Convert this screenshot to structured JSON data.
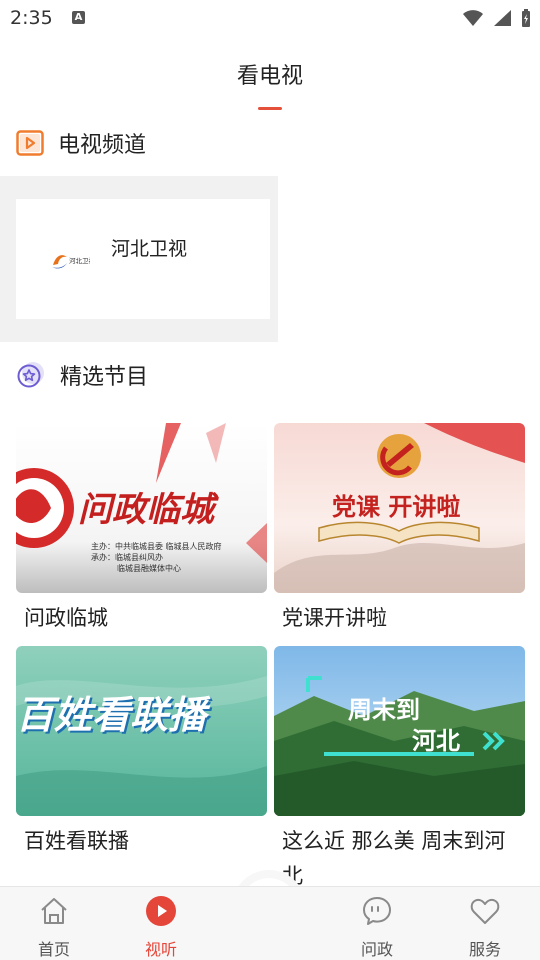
{
  "status_bar": {
    "time": "2:35",
    "notification_icon": "A"
  },
  "header": {
    "title": "看电视"
  },
  "tv_channels": {
    "section_title": "电视频道",
    "section_icon": "play-square-icon",
    "channels": [
      {
        "name": "河北卫视",
        "logo_text": "河北卫视"
      }
    ]
  },
  "featured": {
    "section_title": "精选节目",
    "section_icon": "star-badge-icon",
    "programs": [
      {
        "title": "问政临城",
        "thumb_title": "问政临城",
        "thumb_credits": [
          "主办：中共临城县委 临城县人民政府",
          "承办：临城县纠风办",
          "临城县融媒体中心"
        ]
      },
      {
        "title": "党课开讲啦",
        "thumb_title": "党课  开讲啦"
      },
      {
        "title": "百姓看联播",
        "thumb_title": "百姓看联播"
      },
      {
        "title": "这么近 那么美 周末到河北",
        "thumb_title_line1": "周末到",
        "thumb_title_line2": "河北"
      }
    ]
  },
  "bottom_nav": {
    "items": [
      {
        "label": "首页",
        "icon": "home-icon",
        "active": false
      },
      {
        "label": "视听",
        "icon": "play-circle-icon",
        "active": true
      },
      {
        "label": "问政",
        "icon": "chat-bubble-icon",
        "active": false
      },
      {
        "label": "服务",
        "icon": "heart-icon",
        "active": false
      }
    ],
    "center_icon": "app-logo-icon"
  },
  "colors": {
    "accent": "#e5463a",
    "channel_icon": "#f07c2e",
    "star_icon": "#6c5dd3"
  }
}
